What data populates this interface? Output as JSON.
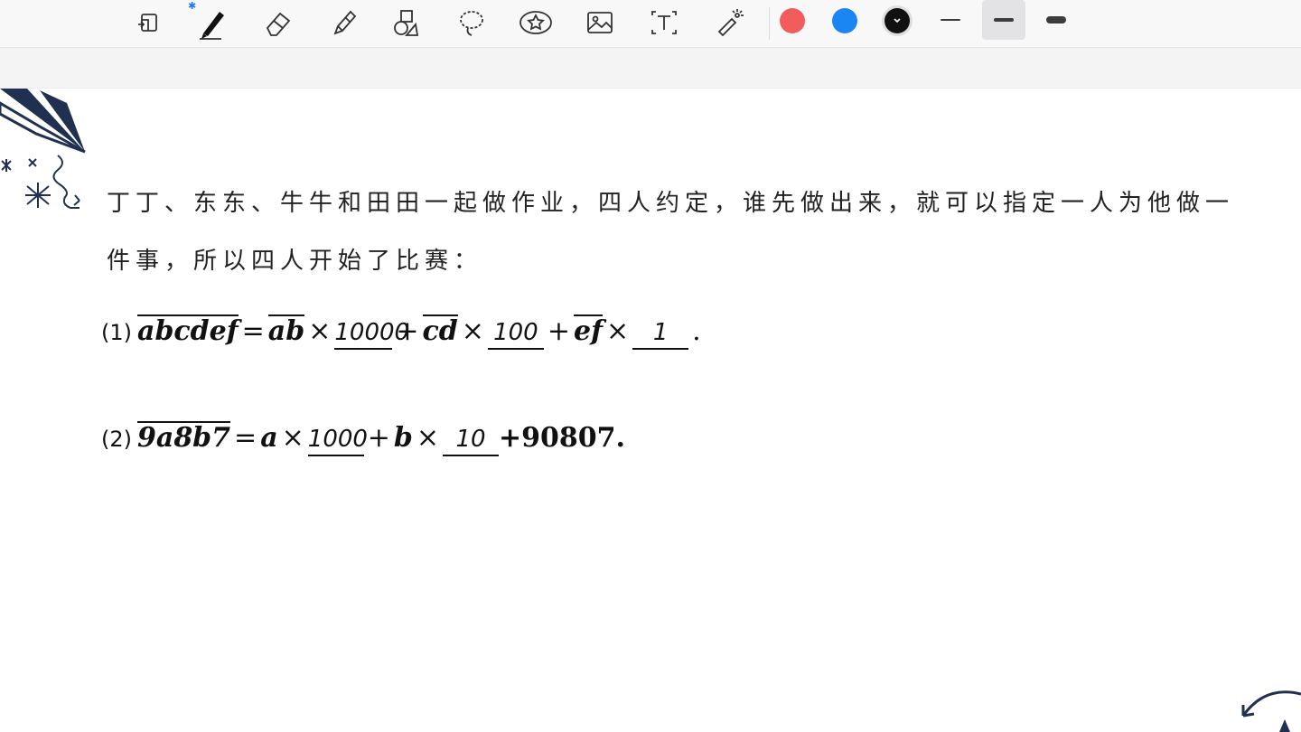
{
  "toolbar": {
    "bluetooth_label": "✱",
    "tools": [
      {
        "name": "page-layout-icon"
      },
      {
        "name": "pen-icon"
      },
      {
        "name": "eraser-icon"
      },
      {
        "name": "highlighter-icon"
      },
      {
        "name": "shapes-icon"
      },
      {
        "name": "lasso-icon"
      },
      {
        "name": "sticker-icon"
      },
      {
        "name": "image-icon"
      },
      {
        "name": "text-icon"
      },
      {
        "name": "laser-pointer-icon"
      }
    ],
    "colors": [
      "#f25c5c",
      "#1a86f3",
      "#111111"
    ],
    "selected_color_index": 2,
    "selected_stroke_index": 1
  },
  "problem": {
    "line1": "丁丁、东东、牛牛和田田一起做作业，四人约定，谁先做出来，就可以指定一人为他做一",
    "line2": "件事，所以四人开始了比赛："
  },
  "eq1": {
    "num": "(1)",
    "lhs": "abcdef",
    "eq": "=",
    "t1": "ab",
    "times": "×",
    "a1": "10000",
    "plus": "+",
    "t2": "cd",
    "a2": "100",
    "t3": "ef",
    "a3": "1",
    "end": "."
  },
  "eq2": {
    "num": "(2)",
    "lhs": "9a8b7",
    "eq": "=",
    "t1": "a",
    "times": "×",
    "a1": "1000",
    "plus": "+",
    "t2": "b",
    "a2": "10",
    "tail": "+90807."
  }
}
